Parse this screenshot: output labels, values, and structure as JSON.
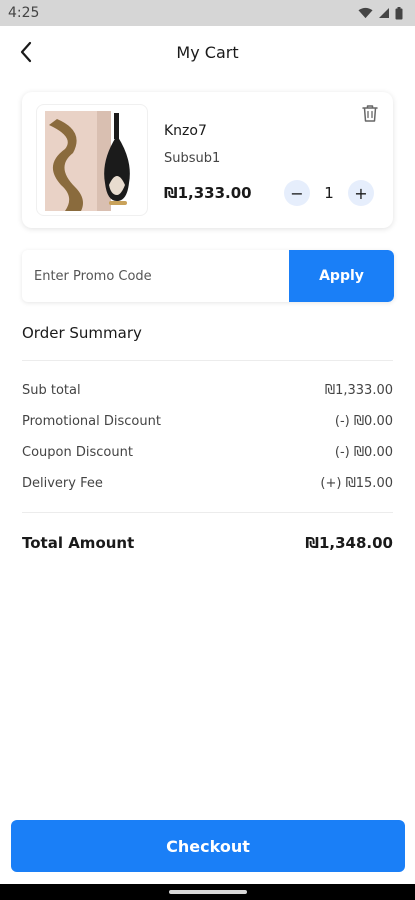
{
  "status_bar": {
    "time": "4:25",
    "icons": [
      "wifi-icon",
      "signal-icon",
      "battery-icon"
    ]
  },
  "header": {
    "title": "My Cart",
    "back_icon": "arrow-left-icon"
  },
  "cart": {
    "items": [
      {
        "name": "Knzo7",
        "variant": "Subsub1",
        "price": "₪1,333.00",
        "quantity": "1",
        "decrement": "−",
        "increment": "+",
        "delete_icon": "trash-icon",
        "image_icon": "perfume-bottle-image"
      }
    ]
  },
  "promo": {
    "placeholder": "Enter Promo Code",
    "apply_label": "Apply"
  },
  "summary": {
    "title": "Order Summary",
    "rows": [
      {
        "label": "Sub total",
        "value": "₪1,333.00"
      },
      {
        "label": "Promotional Discount",
        "value": "(-) ₪0.00"
      },
      {
        "label": "Coupon Discount",
        "value": "(-) ₪0.00"
      },
      {
        "label": "Delivery Fee",
        "value": "(+) ₪15.00"
      }
    ],
    "total_label": "Total Amount",
    "total_value": "₪1,348.00"
  },
  "checkout": {
    "label": "Checkout"
  },
  "colors": {
    "accent": "#1a7ff7",
    "stepper_bg": "#e6eefc"
  }
}
